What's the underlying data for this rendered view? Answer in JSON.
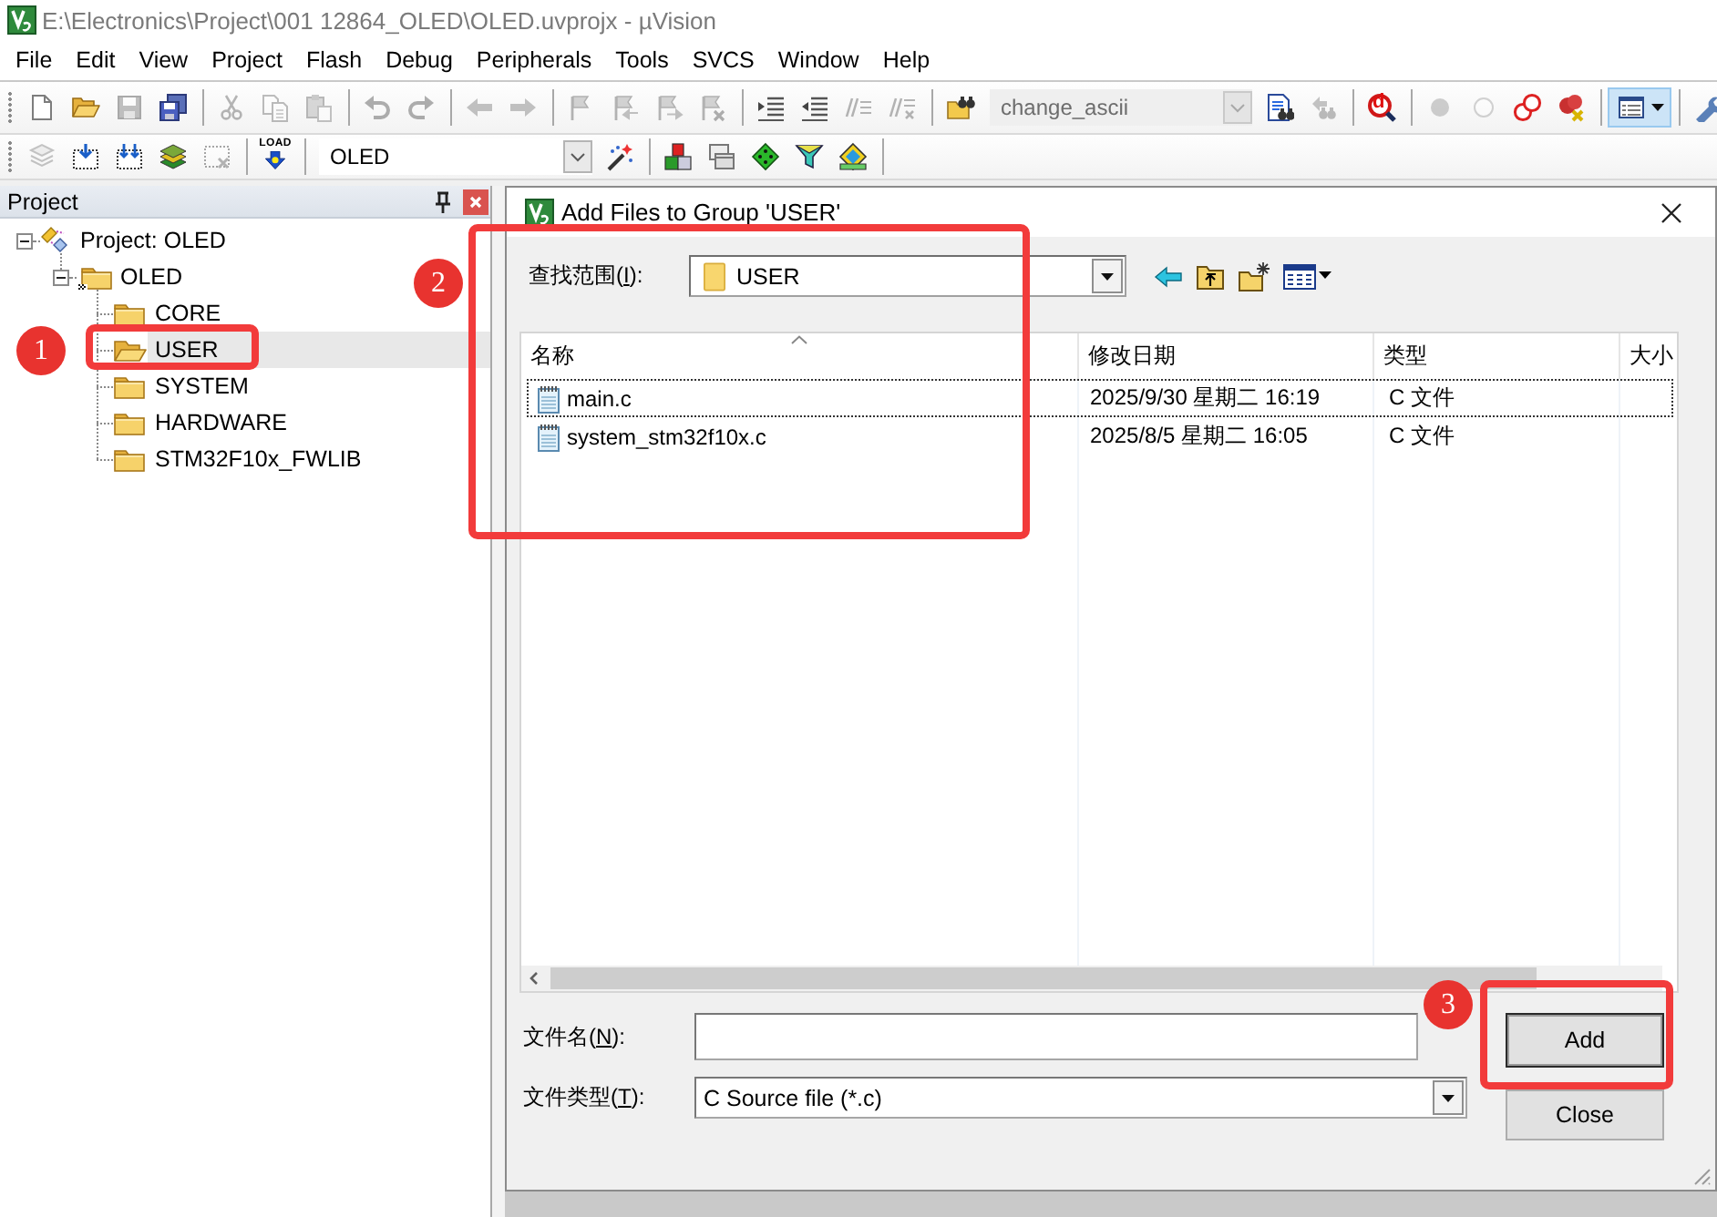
{
  "window": {
    "title": "E:\\Electronics\\Project\\001 12864_OLED\\OLED.uvprojx - µVision"
  },
  "menu": [
    "File",
    "Edit",
    "View",
    "Project",
    "Flash",
    "Debug",
    "Peripherals",
    "Tools",
    "SVCS",
    "Window",
    "Help"
  ],
  "toolbar_1": [
    {
      "buttons": [
        {
          "kind": "new",
          "disabled": false,
          "pressed": false
        },
        {
          "kind": "open",
          "disabled": false,
          "pressed": false
        },
        {
          "kind": "save",
          "disabled": true,
          "pressed": false
        },
        {
          "kind": "save_all",
          "disabled": false,
          "pressed": false
        }
      ]
    },
    {
      "buttons": [
        {
          "kind": "cut",
          "disabled": true,
          "pressed": false
        },
        {
          "kind": "copy",
          "disabled": true,
          "pressed": false
        },
        {
          "kind": "paste",
          "disabled": true,
          "pressed": false
        }
      ]
    },
    {
      "buttons": [
        {
          "kind": "undo",
          "disabled": true,
          "pressed": false
        },
        {
          "kind": "redo",
          "disabled": true,
          "pressed": false
        }
      ]
    },
    {
      "buttons": [
        {
          "kind": "back",
          "disabled": true,
          "pressed": false
        },
        {
          "kind": "forward",
          "disabled": true,
          "pressed": false
        }
      ]
    },
    {
      "buttons": [
        {
          "kind": "bookmark",
          "disabled": true,
          "pressed": false
        },
        {
          "kind": "prev_bookmark",
          "disabled": true,
          "pressed": false
        },
        {
          "kind": "next_bookmark",
          "disabled": true,
          "pressed": false
        },
        {
          "kind": "clear_bookmarks",
          "disabled": true,
          "pressed": false
        }
      ]
    },
    {
      "buttons": [
        {
          "kind": "indent",
          "disabled": false,
          "pressed": false
        },
        {
          "kind": "unindent",
          "disabled": false,
          "pressed": false
        },
        {
          "kind": "comment",
          "disabled": true,
          "pressed": false
        },
        {
          "kind": "uncomment",
          "disabled": true,
          "pressed": false
        }
      ]
    },
    {
      "buttons": [
        {
          "kind": "find_in_files",
          "disabled": false,
          "pressed": false
        },
        {
          "kind": "combo",
          "value": "change_ascii",
          "disabled": true
        },
        {
          "kind": "find",
          "disabled": false,
          "pressed": false
        },
        {
          "kind": "incremental_find",
          "disabled": true,
          "pressed": false
        }
      ]
    },
    {
      "buttons": [
        {
          "kind": "debug",
          "label": "d",
          "disabled": false,
          "pressed": false
        }
      ]
    },
    {
      "buttons": [
        {
          "kind": "breakpoint",
          "disabled": true,
          "pressed": false
        },
        {
          "kind": "breakpoint_off",
          "disabled": true,
          "pressed": false
        },
        {
          "kind": "breakpoints_toggle",
          "disabled": false,
          "pressed": false
        },
        {
          "kind": "breakpoints_kill",
          "disabled": false,
          "pressed": false
        }
      ]
    },
    {
      "buttons": [
        {
          "kind": "window_layout",
          "disabled": false,
          "pressed": true
        }
      ]
    },
    {
      "buttons": [
        {
          "kind": "options",
          "disabled": false,
          "pressed": false
        }
      ]
    }
  ],
  "toolbar_2": [
    {
      "buttons": [
        {
          "kind": "translate",
          "disabled": true,
          "pressed": false
        },
        {
          "kind": "build",
          "disabled": false,
          "pressed": false
        },
        {
          "kind": "rebuild",
          "disabled": false,
          "pressed": false
        },
        {
          "kind": "batch_build",
          "disabled": false,
          "pressed": false
        },
        {
          "kind": "stop_build",
          "disabled": true,
          "pressed": false
        }
      ]
    },
    {
      "buttons": [
        {
          "kind": "download",
          "label": "LOAD",
          "disabled": false,
          "pressed": false
        }
      ]
    },
    {
      "buttons": [
        {
          "kind": "combo",
          "value": "OLED",
          "disabled": false
        },
        {
          "kind": "target_options",
          "disabled": false,
          "pressed": false
        }
      ]
    },
    {
      "buttons": [
        {
          "kind": "manage",
          "disabled": false,
          "pressed": false
        },
        {
          "kind": "windows",
          "disabled": false,
          "pressed": false
        },
        {
          "kind": "diamond",
          "disabled": false,
          "pressed": false
        },
        {
          "kind": "filter",
          "disabled": false,
          "pressed": false
        },
        {
          "kind": "packs",
          "disabled": false,
          "pressed": false
        }
      ]
    }
  ],
  "project_panel": {
    "title": "Project",
    "tree": [
      {
        "label": "Project: OLED",
        "kind": "project",
        "expanded": true,
        "selected": false,
        "children": [
          {
            "label": "OLED",
            "kind": "target",
            "expanded": true,
            "selected": false,
            "children": [
              {
                "label": "CORE",
                "kind": "group",
                "selected": false
              },
              {
                "label": "USER",
                "kind": "group",
                "selected": true
              },
              {
                "label": "SYSTEM",
                "kind": "group",
                "selected": false
              },
              {
                "label": "HARDWARE",
                "kind": "group",
                "selected": false
              },
              {
                "label": "STM32F10x_FWLIB",
                "kind": "group",
                "selected": false
              }
            ]
          }
        ]
      }
    ]
  },
  "dialog": {
    "title": "Add Files to Group 'USER'",
    "look_in": {
      "label_before": "查找范围(",
      "access_key": "I",
      "label_after": "):",
      "value": "USER"
    },
    "columns": [
      {
        "label": "名称",
        "sorted": true
      },
      {
        "label": "修改日期",
        "sorted": false
      },
      {
        "label": "类型",
        "sorted": false
      },
      {
        "label": "大小",
        "sorted": false
      }
    ],
    "files": [
      {
        "name": "main.c",
        "modified": "2025/9/30 星期二 16:19",
        "type": "C 文件",
        "focused": true
      },
      {
        "name": "system_stm32f10x.c",
        "modified": "2025/8/5 星期二 16:05",
        "type": "C 文件",
        "focused": false
      }
    ],
    "file_name": {
      "label_before": "文件名(",
      "access_key": "N",
      "label_after": "):"
    },
    "file_type": {
      "label_before": "文件类型(",
      "access_key": "T",
      "label_after": "):",
      "value": "C Source file (*.c)"
    },
    "buttons": [
      {
        "label": "Add",
        "default": true
      },
      {
        "label": "Close",
        "default": false
      }
    ]
  },
  "annotations": [
    {
      "number": "1"
    },
    {
      "number": "2"
    },
    {
      "number": "3"
    }
  ]
}
